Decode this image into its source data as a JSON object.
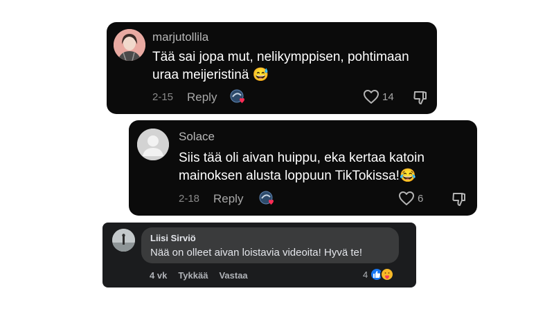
{
  "comments": [
    {
      "username": "marjutollila",
      "text": "Tää sai jopa mut, nelikymppisen, pohtimaan uraa meijeristinä 😅",
      "date": "2-15",
      "reply_label": "Reply",
      "likes": "14"
    },
    {
      "username": "Solace",
      "text": "Siis tää oli aivan huippu, eka kertaa katoin mainoksen alusta loppuun TikTokissa!😂",
      "date": "2-18",
      "reply_label": "Reply",
      "likes": "6"
    }
  ],
  "fb_comment": {
    "name": "Liisi Sirviö",
    "text": "Nää on olleet aivan loistavia videoita! Hyvä te!",
    "time": "4 vk",
    "like_label": "Tykkää",
    "reply_label": "Vastaa",
    "reaction_count": "4"
  },
  "colors": {
    "card_bg": "#0b0b0b",
    "fb_card_bg": "#1b1c1e",
    "fb_bubble": "#3a3b3c",
    "like_blue": "#1877f2",
    "heart_red": "#fe2c55"
  },
  "icons": [
    "heart-outline-icon",
    "dislike-icon",
    "creator-liked-badge",
    "like-reaction-icon",
    "care-reaction-icon"
  ]
}
